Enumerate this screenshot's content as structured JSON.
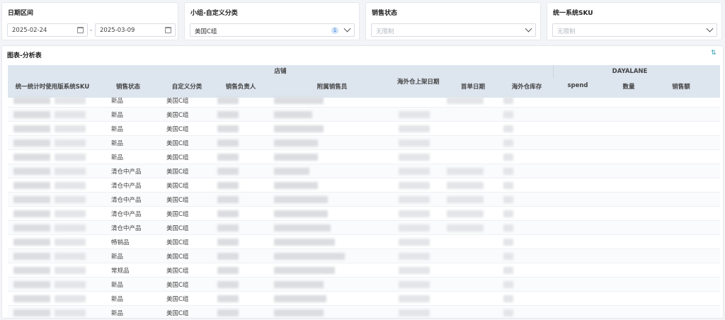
{
  "filters": {
    "date_range": {
      "label": "日期区间",
      "start": "2025-02-24",
      "end": "2025-03-09",
      "sep": "-"
    },
    "group_category": {
      "label": "小组-自定义分类",
      "value": "美国C组",
      "badge": "1"
    },
    "sales_status": {
      "label": "销售状态",
      "placeholder": "无限制"
    },
    "sku": {
      "label": "统一系统SKU",
      "placeholder": "无限制"
    }
  },
  "panel": {
    "title": "图表-分析表",
    "groups": {
      "store": "店铺",
      "channel": "DAYALANE"
    },
    "columns": [
      "统一统计时使用版系统SKU",
      "销售状态",
      "自定义分类",
      "销售负责人",
      "附属销售员",
      "海外仓上架日期",
      "首单日期",
      "海外仓库存",
      "spend",
      "数量",
      "销售额"
    ],
    "rows": [
      {
        "status": "新品",
        "category": "美国C组"
      },
      {
        "status": "新品",
        "category": "美国C组"
      },
      {
        "status": "新品",
        "category": "美国C组"
      },
      {
        "status": "新品",
        "category": "美国C组"
      },
      {
        "status": "新品",
        "category": "美国C组"
      },
      {
        "status": "清仓中产品",
        "category": "美国C组"
      },
      {
        "status": "清仓中产品",
        "category": "美国C组"
      },
      {
        "status": "清仓中产品",
        "category": "美国C组"
      },
      {
        "status": "清仓中产品",
        "category": "美国C组"
      },
      {
        "status": "清仓中产品",
        "category": "美国C组"
      },
      {
        "status": "畅销品",
        "category": "美国C组"
      },
      {
        "status": "新品",
        "category": "美国C组"
      },
      {
        "status": "常规品",
        "category": "美国C组"
      },
      {
        "status": "新品",
        "category": "美国C组"
      },
      {
        "status": "新品",
        "category": "美国C组"
      },
      {
        "status": "新品",
        "category": "美国C组"
      }
    ]
  },
  "colors": {
    "header_bg": "#dde5ef",
    "accent": "#2e9fb0"
  }
}
